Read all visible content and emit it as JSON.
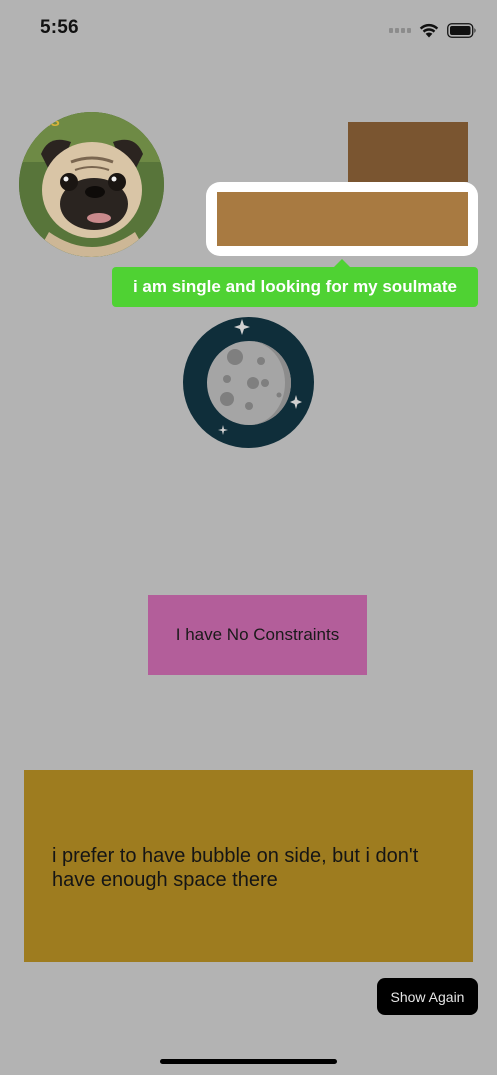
{
  "status_bar": {
    "time": "5:56",
    "signal_icon": "cellular-signal-icon",
    "wifi_icon": "wifi-icon",
    "battery_icon": "battery-icon"
  },
  "avatar": {
    "icon": "pug-photo",
    "logo_text": "ES"
  },
  "tooltip": {
    "text": "i am single and looking for my soulmate",
    "color": "#4fd233"
  },
  "moon_icon": "moon-icon",
  "no_constraints_label": "I have No Constraints",
  "side_bubble_text": "i prefer to have bubble on side, but i don't have enough space there",
  "show_again_label": "Show Again",
  "colors": {
    "background_overlay": "#b3b3b3",
    "brown_dark": "#7a5530",
    "brown_light": "#a87a41",
    "pink": "#b35e9a",
    "gold": "#9e7c1f"
  }
}
